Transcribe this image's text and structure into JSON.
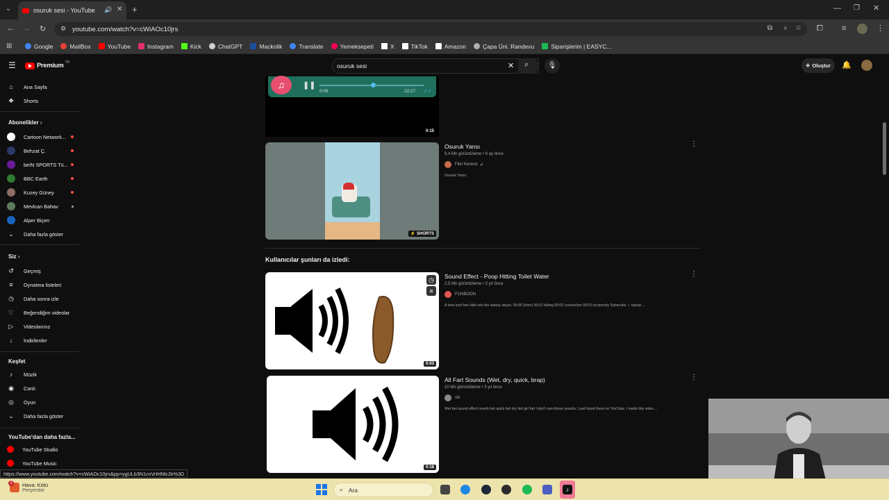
{
  "browser": {
    "tab_title": "osuruk sesi - YouTube",
    "url": "youtube.com/watch?v=cWiAOc10jrs",
    "bookmarks": [
      {
        "label": "Google",
        "color": "#4285f4"
      },
      {
        "label": "MailBox",
        "color": "#ea4335"
      },
      {
        "label": "YouTube",
        "color": "#ff0000"
      },
      {
        "label": "Instagram",
        "color": "#e1306c"
      },
      {
        "label": "Kick",
        "color": "#53fc18"
      },
      {
        "label": "ChatGPT",
        "color": "#cfcfcf"
      },
      {
        "label": "Mackolik",
        "color": "#1c4e9e"
      },
      {
        "label": "Translate",
        "color": "#4285f4"
      },
      {
        "label": "Yemeksepeti",
        "color": "#fa0050"
      },
      {
        "label": "X",
        "color": "#ffffff"
      },
      {
        "label": "TikTok",
        "color": "#ffffff"
      },
      {
        "label": "Amazon",
        "color": "#ffffff"
      },
      {
        "label": "Çapa Üni. Randevu",
        "color": "#b0b0b0"
      },
      {
        "label": "Siparişlerim | EASYC...",
        "color": "#1db954"
      }
    ]
  },
  "youtube": {
    "logo": "Premium",
    "logo_sup": "TR",
    "search_query": "osuruk sesi",
    "create_label": "Oluştur"
  },
  "sidebar": {
    "main": [
      {
        "label": "Ana Sayfa",
        "icon": "home-icon"
      },
      {
        "label": "Shorts",
        "icon": "shorts-icon"
      }
    ],
    "subs_header": "Abonelikler",
    "subs": [
      {
        "label": "Cartoon Network...",
        "color": "#ffffff"
      },
      {
        "label": "Behzat Ç.",
        "color": "#2b3a67"
      },
      {
        "label": "beIN SPORTS Tü...",
        "color": "#6a1b9a"
      },
      {
        "label": "BBC Earth",
        "color": "#2e7d32"
      },
      {
        "label": "Kuzey Güney",
        "color": "#8d6e63"
      },
      {
        "label": "Mevlcan Bahav",
        "color": "#5d7a5d"
      },
      {
        "label": "Alper Biçen",
        "color": "#1565c0"
      }
    ],
    "show_more": "Daha fazla göster",
    "you_header": "Siz",
    "you": [
      {
        "label": "Geçmiş",
        "icon": "history-icon"
      },
      {
        "label": "Oynatma listeleri",
        "icon": "playlist-icon"
      },
      {
        "label": "Daha sonra izle",
        "icon": "clock-icon"
      },
      {
        "label": "Beğendiğim videolar",
        "icon": "like-icon"
      },
      {
        "label": "Videolarınız",
        "icon": "video-icon"
      },
      {
        "label": "İndirilenler",
        "icon": "download-icon"
      }
    ],
    "explore_header": "Keşfet",
    "explore": [
      {
        "label": "Müzik",
        "icon": "music-icon"
      },
      {
        "label": "Canlı",
        "icon": "live-icon"
      },
      {
        "label": "Oyun",
        "icon": "game-icon"
      }
    ],
    "explore_more": "Daha fazla göster",
    "more_header": "YouTube'dan daha fazla...",
    "more": [
      {
        "label": "YouTube Studio"
      },
      {
        "label": "YouTube Music"
      }
    ]
  },
  "player_snippet": {
    "time_left": "0:06",
    "time_right": "22:27",
    "duration": "0:15"
  },
  "videos": [
    {
      "title": "Osuruk Yansı",
      "meta": "9,4 Mn görüntüleme • 8 ay önce",
      "channel": "Fikri Kereviz",
      "desc": "Osuruk Yansı.",
      "badge": "SHORTS"
    }
  ],
  "section_title": "Kullanıcılar şunları da izledi:",
  "related": [
    {
      "title": "Sound Effect - Poop Hitting Toilet Water",
      "meta": "2,5 Mn görüntüleme • 2 yıl önce",
      "channel": "FUNBOON",
      "desc": "A lone turd free falls into the watery abyss. 00:00 (Intro) 00:01 falling 00:02 connection 00:03 reciprocity Subscribe ✓ #poop ...",
      "duration": "0:03"
    },
    {
      "title": "All Fart Sounds (Wet, dry, quick, brap)",
      "meta": "10 Mn görüntüleme • 3 yıl önce",
      "channel": "sfx",
      "desc": "Wet fart sound effect reverb fart quick fart dry fart girl fart I don't own these sounds, I just found them on YouTube. I made this video ...",
      "duration": "0:18"
    }
  ],
  "status_url": "https://www.youtube.com/watch?v=cWiAOc10jrs&pp=ygULb3N1cnVrIHNlc2k%3D",
  "taskbar": {
    "weather_title": "Hava: Kötü",
    "weather_sub": "Perşembe",
    "search_label": "Ara",
    "badge": "2"
  }
}
